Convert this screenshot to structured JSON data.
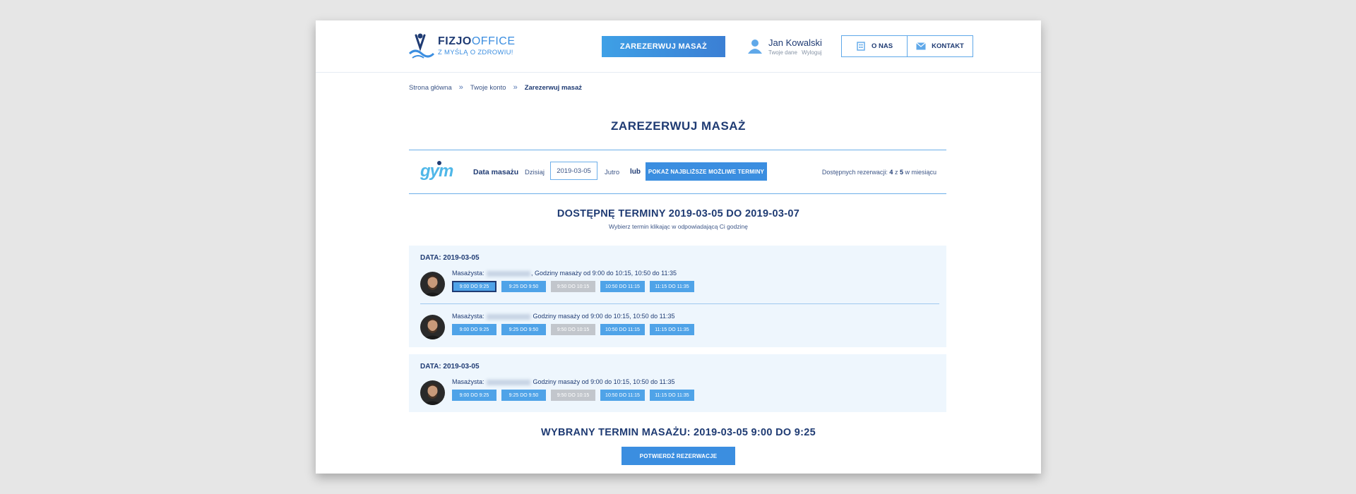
{
  "header": {
    "logo_name_part1": "FIZJO",
    "logo_name_part2": "OFFICE",
    "logo_tagline": "Z MYŚLĄ O ZDROWIU!",
    "reserve_button": "ZAREZERWUJ MASAŻ",
    "user_name": "Jan Kowalski",
    "user_link_data": "Twoje dane",
    "user_link_logout": "Wyloguj",
    "nav": [
      {
        "label": "O NAS",
        "icon": "building-icon"
      },
      {
        "label": "KONTAKT",
        "icon": "envelope-icon"
      }
    ]
  },
  "breadcrumb": [
    "Strona główna",
    "Twoje konto",
    "Zarezerwuj masaż"
  ],
  "page_title": "ZAREZERWUJ MASAŻ",
  "filter": {
    "gym_logo_text": "gym",
    "label": "Data masażu",
    "today": "Dzisiaj",
    "date_value": "2019-03-05",
    "tomorrow": "Jutro",
    "or": "lub",
    "nearest_button": "POKAŻ NAJBLIŻSZE MOŻLIWE TERMINY",
    "avail_prefix": "Dostępnych rezerwacji:",
    "avail_count": "4",
    "avail_mid": "z",
    "avail_total": "5",
    "avail_suffix": "w miesiącu"
  },
  "available": {
    "title": "DOSTĘPNĘ TERMINY 2019-03-05 DO 2019-03-07",
    "subtitle": "Wybierz termin klikając w odpowiadającą Ci godzinę"
  },
  "blocks": [
    {
      "date_label": "DATA: 2019-03-05",
      "therapists": [
        {
          "label": "Masażysta:",
          "hours": ", Godziny masaży od 9:00 do 10:15, 10:50 do 11:35",
          "slots": [
            "9:00 DO 9:25",
            "9:25 DO 9:50",
            "9:50 DO 10:15",
            "10:50 DO 11:15",
            "11:15 DO 11:35"
          ]
        },
        {
          "label": "Masażysta:",
          "hours": "Godziny masaży od 9:00 do 10:15, 10:50 do 11:35",
          "slots": [
            "9:00 DO 9:25",
            "9:25 DO 9:50",
            "9:50 DO 10:15",
            "10:50 DO 11:15",
            "11:15 DO 11:35"
          ]
        }
      ]
    },
    {
      "date_label": "DATA: 2019-03-05",
      "therapists": [
        {
          "label": "Masażysta:",
          "hours": "Godziny masaży od 9:00 do 10:15, 10:50 do 11:35",
          "slots": [
            "9:00 DO 9:25",
            "9:25 DO 9:50",
            "9:50 DO 10:15",
            "10:50 DO 11:15",
            "11:15 DO 11:35"
          ]
        }
      ]
    }
  ],
  "chosen_title": "WYBRANY TERMIN MASAŻU: 2019-03-05 9:00 DO 9:25",
  "confirm_button": "POTWIERDŹ REZERWACJE",
  "colors": {
    "primary": "#3b8ee0",
    "navy": "#1f3b73",
    "disabled_slot": "#c2c6cc",
    "block_bg": "#eef6fd"
  }
}
